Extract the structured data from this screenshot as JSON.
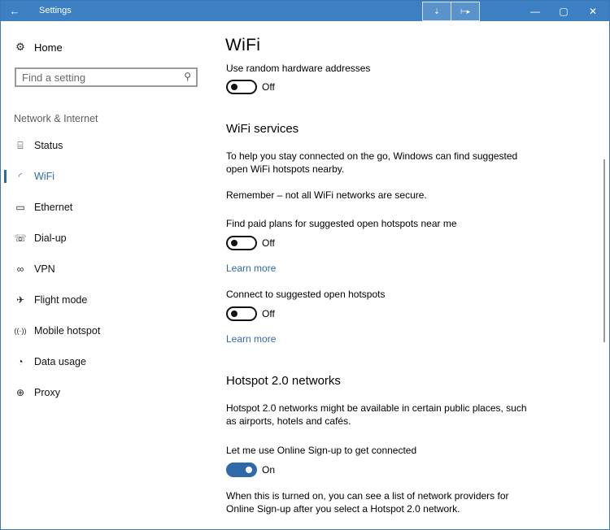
{
  "window": {
    "title": "Settings",
    "back_glyph": "←",
    "extra_buttons": [
      "⇣",
      "⊢▸"
    ],
    "minimize_glyph": "—",
    "maximize_glyph": "▢",
    "close_glyph": "✕"
  },
  "sidebar": {
    "home_label": "Home",
    "search_placeholder": "Find a setting",
    "section_label": "Network & Internet",
    "items": [
      {
        "label": "Status",
        "icon": "⌸",
        "active": false
      },
      {
        "label": "WiFi",
        "icon": "◜",
        "active": true
      },
      {
        "label": "Ethernet",
        "icon": "▭",
        "active": false
      },
      {
        "label": "Dial-up",
        "icon": "☏",
        "active": false
      },
      {
        "label": "VPN",
        "icon": "∞",
        "active": false
      },
      {
        "label": "Flight mode",
        "icon": "✈",
        "active": false
      },
      {
        "label": "Mobile hotspot",
        "icon": "((·))",
        "active": false
      },
      {
        "label": "Data usage",
        "icon": "◔",
        "active": false
      },
      {
        "label": "Proxy",
        "icon": "⊕",
        "active": false
      }
    ]
  },
  "main": {
    "title": "WiFi",
    "random_hw_label": "Use random hardware addresses",
    "random_hw_state": "Off",
    "services_heading": "WiFi services",
    "services_desc": "To help you stay connected on the go, Windows can find suggested open WiFi hotspots nearby.",
    "remember_text": "Remember – not all WiFi networks are secure.",
    "paid_plans_label": "Find paid plans for suggested open hotspots near me",
    "paid_plans_state": "Off",
    "learn_more_1": "Learn more",
    "connect_label": "Connect to suggested open hotspots",
    "connect_state": "Off",
    "learn_more_2": "Learn more",
    "hotspot_heading": "Hotspot 2.0 networks",
    "hotspot_desc": "Hotspot 2.0 networks might be available in certain public places, such as airports, hotels and cafés.",
    "signup_label": "Let me use Online Sign-up to get connected",
    "signup_state": "On",
    "signup_desc": "When this is turned on, you can see a list of network providers for Online Sign-up after you select a Hotspot 2.0 network."
  },
  "colors": {
    "titlebar": "#3d7fc3",
    "accent": "#2f6aa8"
  }
}
